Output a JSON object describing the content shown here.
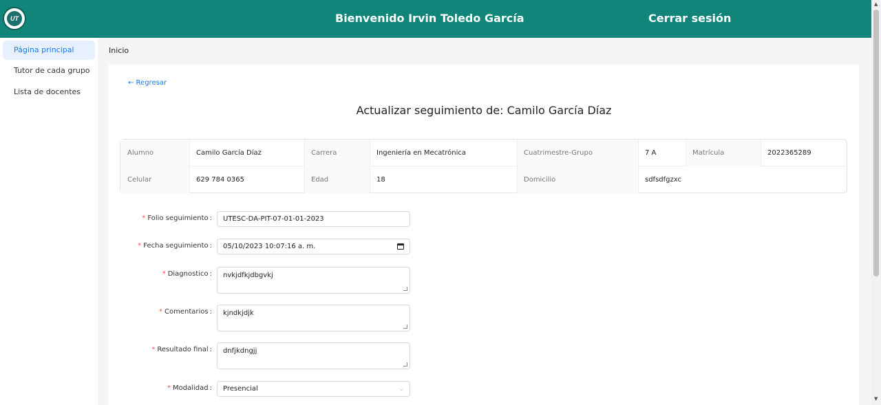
{
  "header": {
    "logo_text": "UT",
    "welcome": "Bienvenido Irvin Toledo García",
    "logout": "Cerrar sesión"
  },
  "sidebar": {
    "items": [
      {
        "label": "Página principal",
        "active": true
      },
      {
        "label": "Tutor de cada grupo",
        "active": false
      },
      {
        "label": "Lista de docentes",
        "active": false
      }
    ]
  },
  "breadcrumb": "Inicio",
  "back": "← Regresar",
  "title": "Actualizar seguimiento de: Camilo García Díaz",
  "student": {
    "alumno_label": "Alumno",
    "alumno": "Camilo García Díaz",
    "carrera_label": "Carrera",
    "carrera": "Ingeniería en Mecatrónica",
    "cuatri_label": "Cuatrimestre-Grupo",
    "cuatri": "7 A",
    "matricula_label": "Matrícula",
    "matricula": "2022365289",
    "celular_label": "Celular",
    "celular": "629 784 0365",
    "edad_label": "Edad",
    "edad": "18",
    "domicilio_label": "Domicilio",
    "domicilio": "sdfsdfgzxc"
  },
  "form": {
    "folio_label": "Folio seguimiento",
    "folio": "UTESC-DA-PIT-07-01-01-2023",
    "fecha_label": "Fecha seguimiento",
    "fecha": "05/10/2023 10:07:16 a. m.",
    "diagnostico_label": "Diagnostico",
    "diagnostico": "nvkjdfkjdbgvkj",
    "comentarios_label": "Comentarios",
    "comentarios": "kjndkjdjk",
    "resultado_label": "Resultado final",
    "resultado": "dnfjkdngjj",
    "modalidad_label": "Modalidad",
    "modalidad": "Presencial"
  },
  "colors": {
    "header": "#12857a",
    "accent": "#1677ff",
    "required": "#ff4d4f"
  }
}
